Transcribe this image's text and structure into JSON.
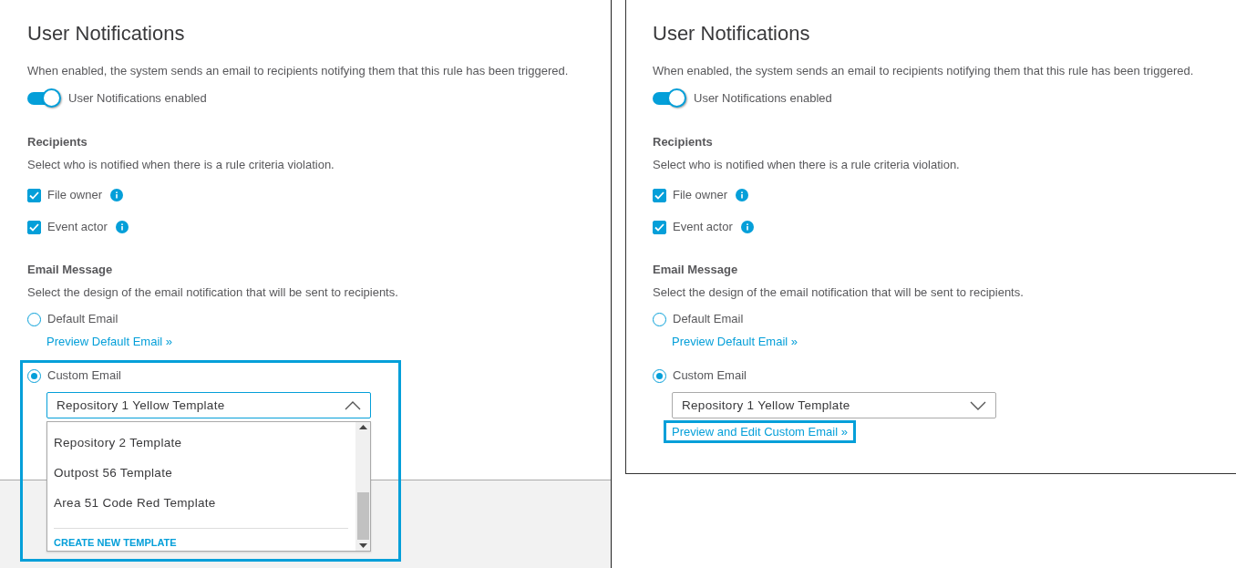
{
  "panels": [
    {
      "kind": "page",
      "title": "User Notifications",
      "description": "When enabled, the system sends an email to recipients notifying them that this rule has been triggered.",
      "toggle": {
        "label": "User Notifications enabled",
        "on": true
      },
      "recipients": {
        "heading": "Recipients",
        "text": "Select who is notified when there is a rule criteria violation.",
        "options": [
          {
            "label": "File owner",
            "checked": true
          },
          {
            "label": "Event actor",
            "checked": true
          }
        ]
      },
      "email": {
        "heading": "Email Message",
        "text": "Select the design of the email notification that will be sent to recipients.",
        "options": [
          {
            "label": "Default Email",
            "selected": false,
            "highlighted": false,
            "link": {
              "label": "Preview Default Email »",
              "highlighted": false
            }
          },
          {
            "label": "Custom Email",
            "selected": true,
            "highlighted": true,
            "dropdown": {
              "value": "Repository 1 Yellow Template",
              "expanded": true,
              "items": [
                "Repository 2 Template",
                "Outpost 56 Template",
                "Area 51 Code Red Template"
              ],
              "action": "CREATE NEW TEMPLATE"
            }
          }
        ]
      }
    },
    {
      "kind": "card",
      "title": "User Notifications",
      "description": "When enabled, the system sends an email to recipients notifying them that this rule has been triggered.",
      "toggle": {
        "label": "User Notifications enabled",
        "on": true
      },
      "recipients": {
        "heading": "Recipients",
        "text": "Select who is notified when there is a rule criteria violation.",
        "options": [
          {
            "label": "File owner",
            "checked": true
          },
          {
            "label": "Event actor",
            "checked": true
          }
        ]
      },
      "email": {
        "heading": "Email Message",
        "text": "Select the design of the email notification that will be sent to recipients.",
        "options": [
          {
            "label": "Default Email",
            "selected": false,
            "highlighted": false,
            "link": {
              "label": "Preview Default Email »",
              "highlighted": false
            }
          },
          {
            "label": "Custom Email",
            "selected": true,
            "highlighted": false,
            "dropdown": {
              "value": "Repository 1 Yellow Template",
              "expanded": false
            },
            "link": {
              "label": "Preview and Edit Custom Email »",
              "highlighted": true
            }
          }
        ]
      }
    }
  ]
}
